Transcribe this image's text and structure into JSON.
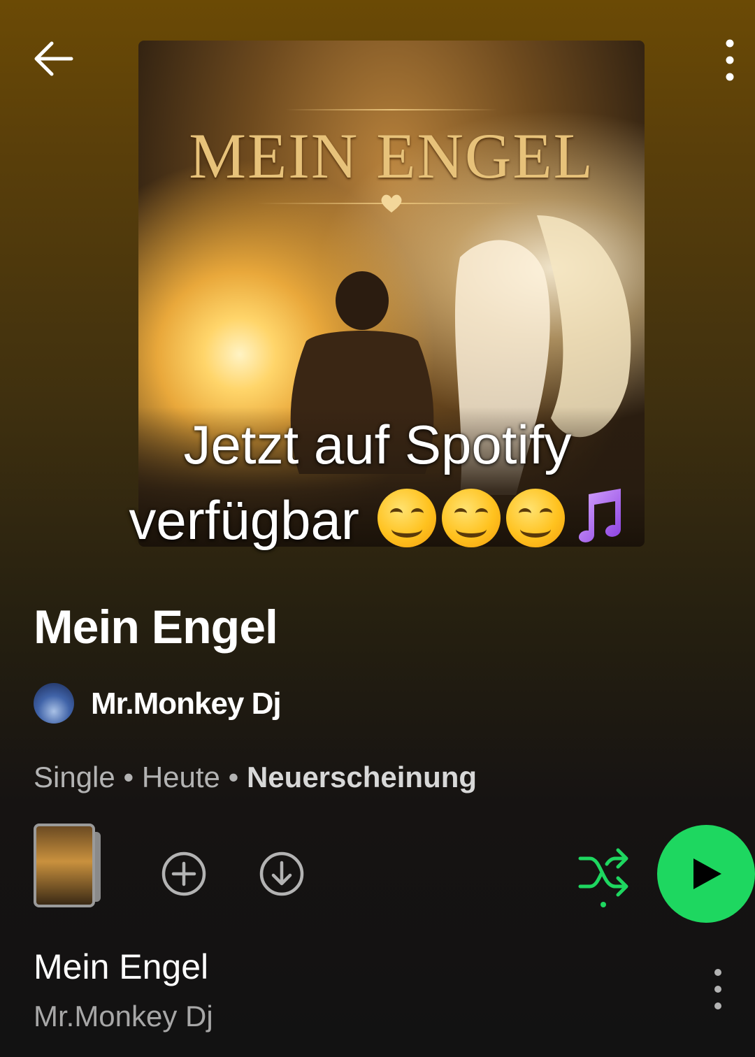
{
  "header": {
    "back_icon": "arrow-left-icon",
    "more_icon": "more-vertical-icon"
  },
  "cover": {
    "art_title": "MEIN ENGEL",
    "overlay_caption_line1": "Jetzt auf Spotify",
    "overlay_caption_line2": "verfügbar",
    "overlay_emojis": "😊😊😊🎵"
  },
  "album": {
    "title": "Mein Engel",
    "artist": "Mr.Monkey Dj",
    "type": "Single",
    "separator": "•",
    "date": "Heute",
    "badge": "Neuerscheinung"
  },
  "actions": {
    "add_icon": "plus-circle-icon",
    "download_icon": "download-circle-icon",
    "shuffle_icon": "shuffle-icon",
    "play_icon": "play-icon",
    "accent_color": "#1ed760"
  },
  "tracks": [
    {
      "title": "Mein Engel",
      "artist": "Mr.Monkey Dj"
    }
  ]
}
